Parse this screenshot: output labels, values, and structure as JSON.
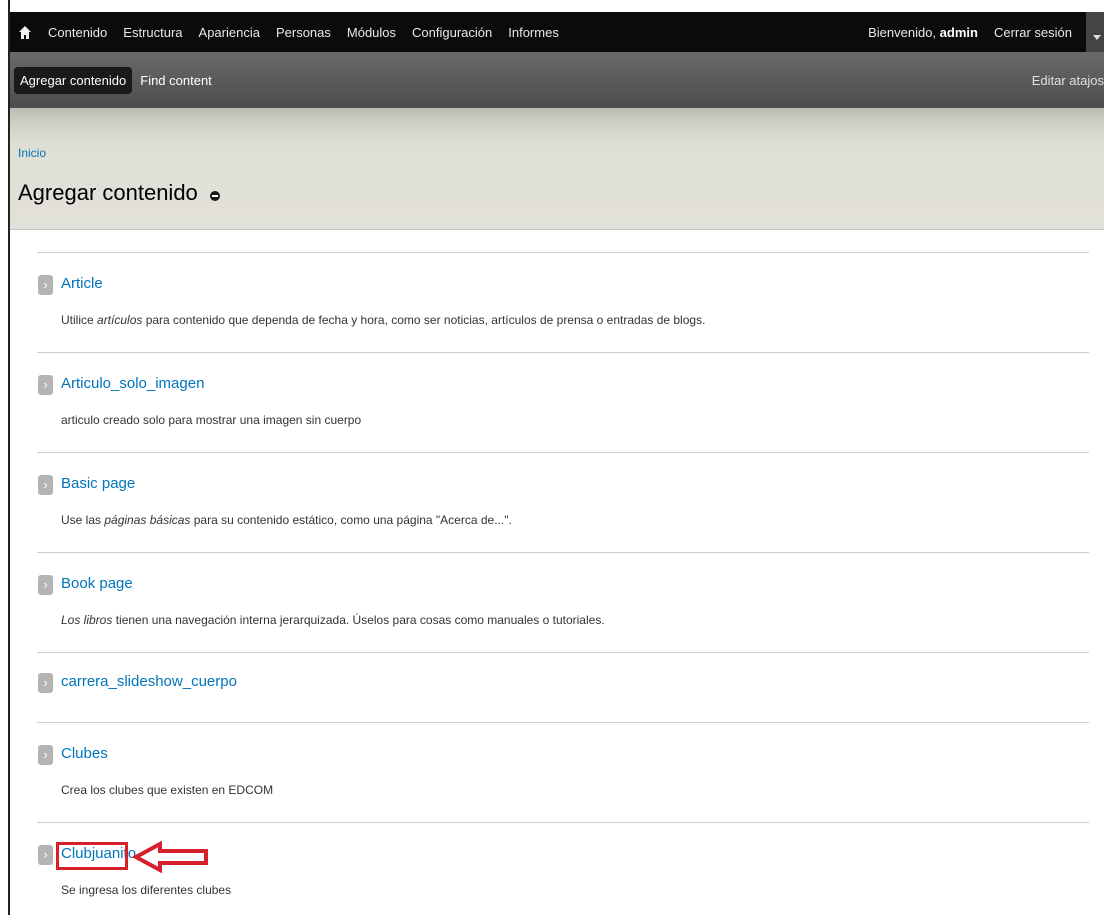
{
  "toolbar": {
    "menu": [
      "Contenido",
      "Estructura",
      "Apariencia",
      "Personas",
      "Módulos",
      "Configuración",
      "Informes"
    ],
    "welcome_prefix": "Bienvenido,",
    "username": "admin",
    "logout": "Cerrar sesión"
  },
  "shortcuts": {
    "add_content": "Agregar contenido",
    "find_content": "Find content",
    "edit_shortcuts": "Editar atajos"
  },
  "header": {
    "breadcrumb": "Inicio",
    "title": "Agregar contenido"
  },
  "content_types": [
    {
      "title": "Article",
      "desc_before": "Utilice ",
      "desc_em": "artículos",
      "desc_after": " para contenido que dependa de fecha y hora, como ser noticias, artículos de prensa o entradas de blogs."
    },
    {
      "title": "Articulo_solo_imagen",
      "desc_before": "articulo creado solo para mostrar una imagen sin cuerpo",
      "desc_em": "",
      "desc_after": ""
    },
    {
      "title": "Basic page",
      "desc_before": "Use las ",
      "desc_em": "páginas básicas",
      "desc_after": " para su contenido estático, como una página \"Acerca de...\"."
    },
    {
      "title": "Book page",
      "desc_before": "",
      "desc_em": "Los libros",
      "desc_after": " tienen una navegación interna jerarquizada. Úselos para cosas como manuales o tutoriales."
    },
    {
      "title": "carrera_slideshow_cuerpo",
      "desc_before": "",
      "desc_em": "",
      "desc_after": ""
    },
    {
      "title": "Clubes",
      "desc_before": "Crea los clubes que existen en EDCOM",
      "desc_em": "",
      "desc_after": ""
    },
    {
      "title": "Clubjuanito",
      "desc_before": "Se ingresa los diferentes clubes",
      "desc_em": "",
      "desc_after": ""
    }
  ],
  "colors": {
    "link": "#0074bd",
    "annotation": "#d6202b",
    "toolbar_bg": "#0b0b0b"
  },
  "icons": {
    "home": "home-icon",
    "chevron": "chevron-right-icon",
    "shortcut_toggle": "minus-circle-icon",
    "annotation_arrow": "left-arrow-icon"
  }
}
